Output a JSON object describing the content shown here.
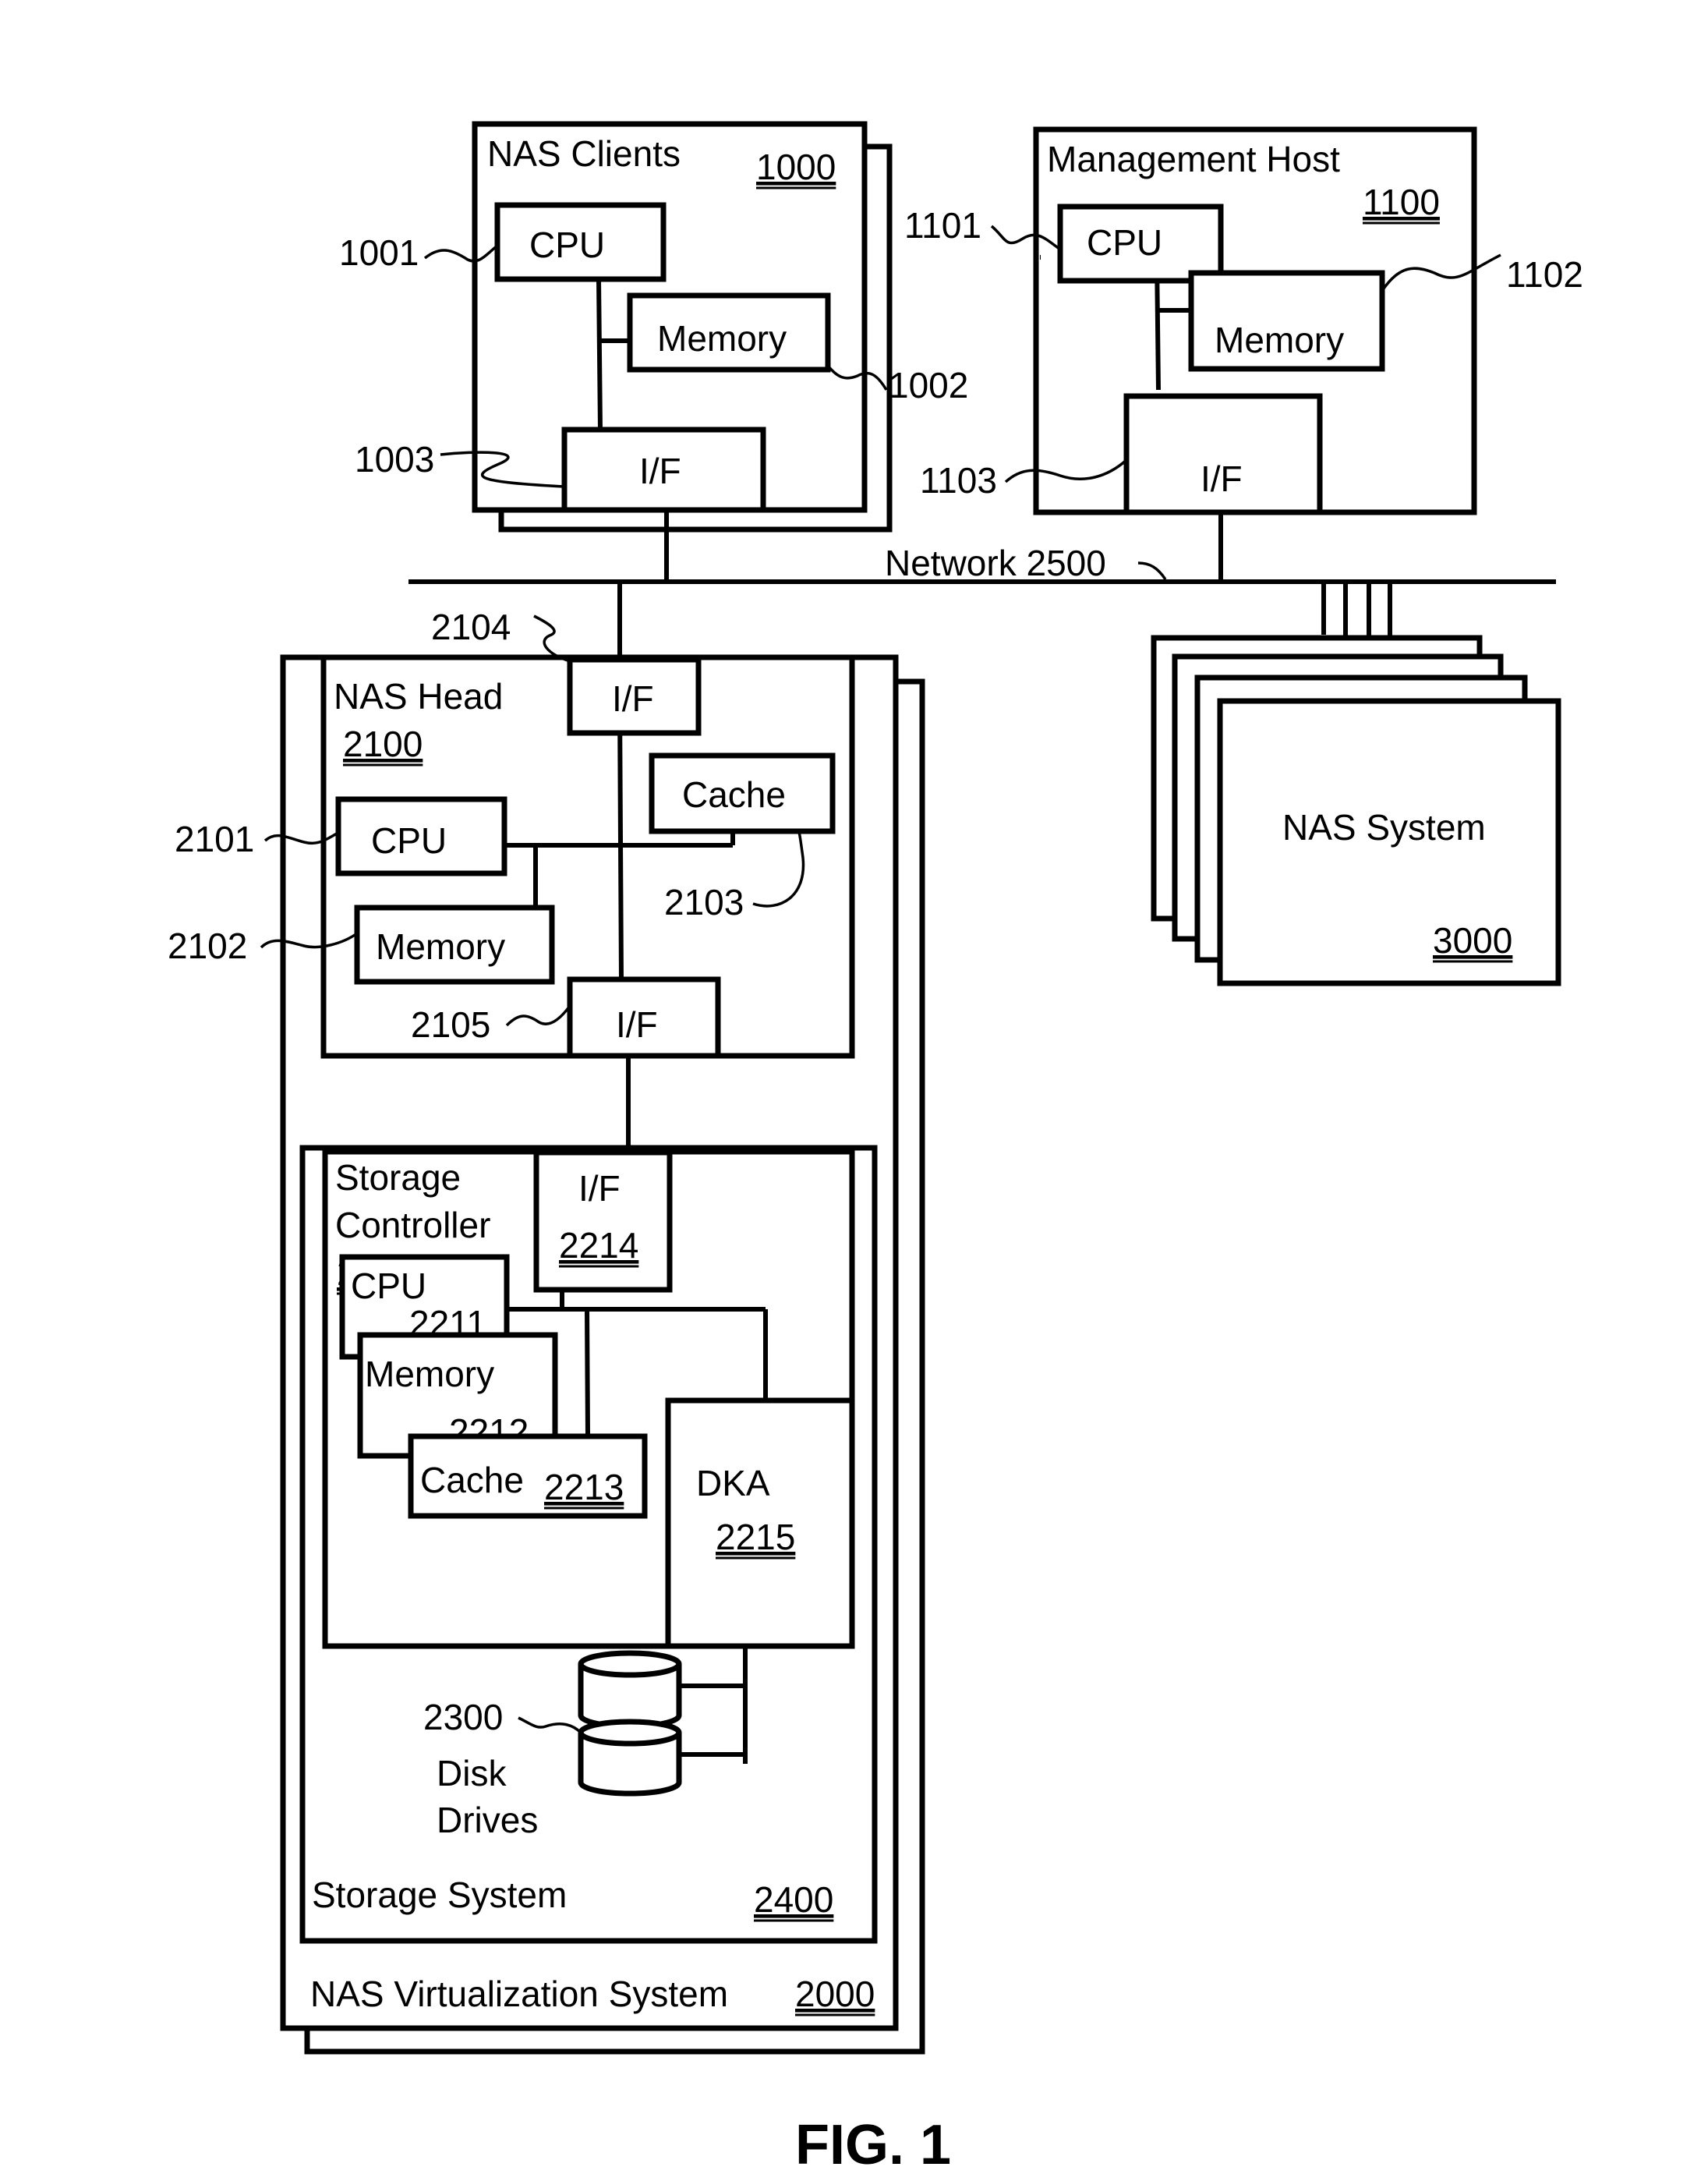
{
  "figure": {
    "caption": "FIG. 1",
    "nas_clients": {
      "title": "NAS Clients",
      "ref": "1000",
      "cpu": {
        "label": "CPU",
        "ref": "1001"
      },
      "memory": {
        "label": "Memory",
        "ref": "1002"
      },
      "interface": {
        "label": "I/F",
        "ref": "1003"
      }
    },
    "management_host": {
      "title": "Management Host",
      "ref": "1100",
      "cpu": {
        "label": "CPU",
        "ref": "1101"
      },
      "memory": {
        "label": "Memory",
        "ref": "1102"
      },
      "interface": {
        "label": "I/F",
        "ref": "1103"
      }
    },
    "network": {
      "label": "Network 2500"
    },
    "nas_head": {
      "title": "NAS Head",
      "ref": "2100",
      "cpu": {
        "label": "CPU",
        "ref": "2101"
      },
      "memory": {
        "label": "Memory",
        "ref": "2102"
      },
      "cache": {
        "label": "Cache",
        "ref": "2103"
      },
      "interface_top": {
        "label": "I/F",
        "ref": "2104"
      },
      "interface_bottom": {
        "label": "I/F",
        "ref": "2105"
      }
    },
    "storage_controller": {
      "title_line1": "Storage",
      "title_line2": "Controller",
      "ref": "2200",
      "cpu": {
        "label": "CPU",
        "ref": "2211"
      },
      "memory": {
        "label": "Memory",
        "ref": "2212"
      },
      "cache": {
        "label": "Cache",
        "ref": "2213"
      },
      "interface": {
        "label": "I/F",
        "ref": "2214"
      },
      "dka": {
        "label": "DKA",
        "ref": "2215"
      }
    },
    "disk_drives": {
      "ref": "2300",
      "label_line1": "Disk",
      "label_line2": "Drives"
    },
    "storage_system": {
      "title": "Storage System",
      "ref": "2400"
    },
    "nas_virtualization_system": {
      "title": "NAS Virtualization System",
      "ref": "2000"
    },
    "nas_system": {
      "title": "NAS System",
      "ref": "3000"
    }
  }
}
